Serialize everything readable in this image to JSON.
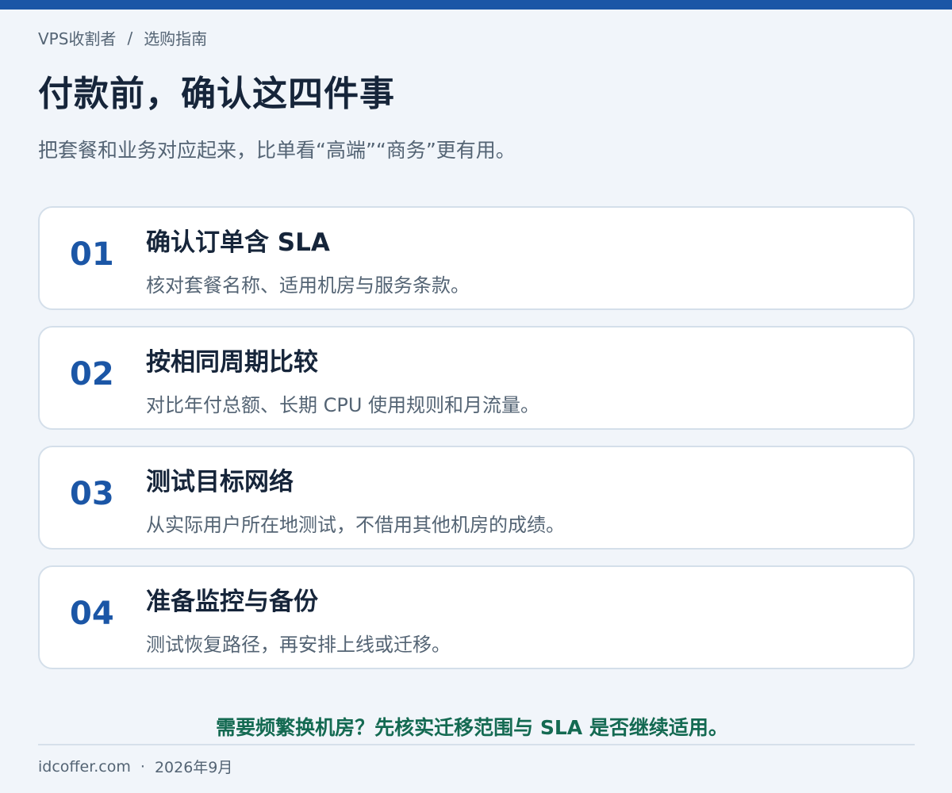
{
  "theme": {
    "accent": "#1b56a6",
    "title": "#16253a",
    "muted": "#546474",
    "callout": "#146a52"
  },
  "breadcrumb": {
    "home": "VPS收割者",
    "separator": "/",
    "current": "选购指南"
  },
  "page": {
    "title": "付款前，确认这四件事",
    "subtitle": "把套餐和业务对应起来，比单看“高端”“商务”更有用。"
  },
  "steps": [
    {
      "number": "01",
      "title": "确认订单含 SLA",
      "desc": "核对套餐名称、适用机房与服务条款。"
    },
    {
      "number": "02",
      "title": "按相同周期比较",
      "desc": "对比年付总额、长期 CPU 使用规则和月流量。"
    },
    {
      "number": "03",
      "title": "测试目标网络",
      "desc": "从实际用户所在地测试，不借用其他机房的成绩。"
    },
    {
      "number": "04",
      "title": "准备监控与备份",
      "desc": "测试恢复路径，再安排上线或迁移。"
    }
  ],
  "callout": "需要频繁换机房？先核实迁移范围与 SLA 是否继续适用。",
  "footer": {
    "site": "idcoffer.com",
    "separator": "·",
    "date": "2026年9月"
  }
}
